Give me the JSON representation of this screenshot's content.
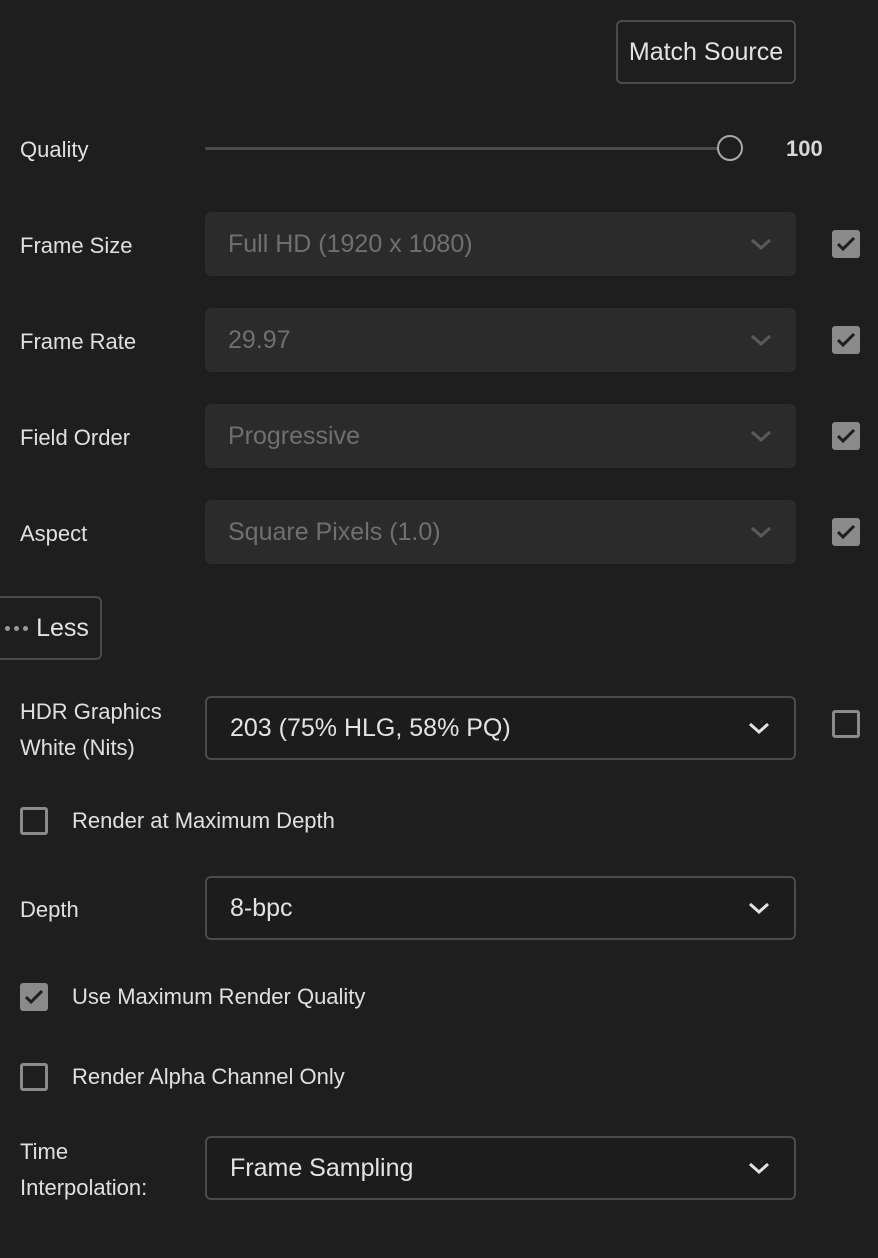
{
  "match_source_label": "Match Source",
  "quality": {
    "label": "Quality",
    "value": "100",
    "fraction": 1.0
  },
  "frame_size": {
    "label": "Frame Size",
    "value": "Full HD (1920 x 1080)",
    "checked": true
  },
  "frame_rate": {
    "label": "Frame Rate",
    "value": "29.97",
    "checked": true
  },
  "field_order": {
    "label": "Field Order",
    "value": "Progressive",
    "checked": true
  },
  "aspect": {
    "label": "Aspect",
    "value": "Square Pixels (1.0)",
    "checked": true
  },
  "less_label": "Less",
  "hdr": {
    "label_line1": "HDR Graphics",
    "label_line2": "White (Nits)",
    "value": "203 (75% HLG, 58% PQ)",
    "checked": false
  },
  "render_max_depth": {
    "label": "Render at Maximum Depth",
    "checked": false
  },
  "depth": {
    "label": "Depth",
    "value": "8-bpc"
  },
  "max_render_quality": {
    "label": "Use Maximum Render Quality",
    "checked": true
  },
  "alpha_only": {
    "label": "Render Alpha Channel Only",
    "checked": false
  },
  "time_interp": {
    "label_line1": "Time",
    "label_line2": "Interpolation:",
    "value": "Frame Sampling"
  },
  "colors": {
    "background": "#1e1e1e",
    "checkbox": "#8a8a8a",
    "disabled_field": "#2b2b2b"
  },
  "icons": {
    "dropdown": "chevron-down-icon",
    "check": "checkmark-icon",
    "more": "ellipsis-icon"
  }
}
